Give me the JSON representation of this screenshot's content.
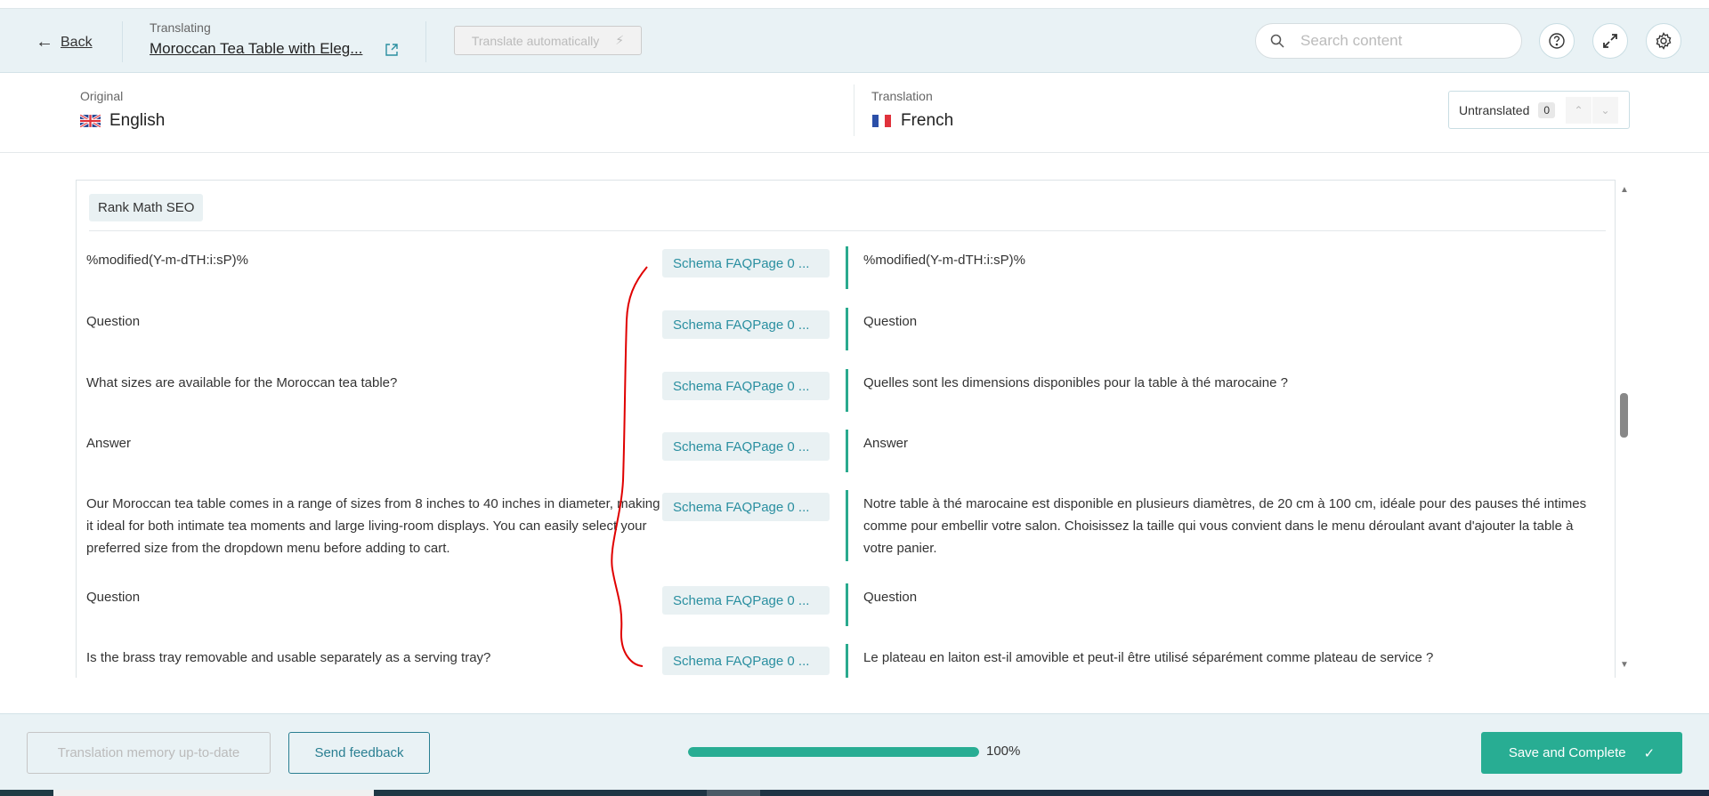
{
  "header": {
    "back_label": "Back",
    "translating_label": "Translating",
    "title": "Moroccan Tea Table with Eleg...",
    "auto_translate_label": "Translate automatically",
    "search_placeholder": "Search content"
  },
  "languages": {
    "original_label": "Original",
    "original_lang": "English",
    "translation_label": "Translation",
    "translation_lang": "French",
    "untranslated_label": "Untranslated",
    "untranslated_count": "0"
  },
  "content": {
    "section": "Rank Math SEO",
    "rows": [
      {
        "source": "%modified(Y-m-dTH:i:sP)%",
        "tag": "Schema FAQPage 0 ...",
        "target": "%modified(Y-m-dTH:i:sP)%"
      },
      {
        "source": "Question",
        "tag": "Schema FAQPage 0 ...",
        "target": "Question"
      },
      {
        "source": "What sizes are available for the Moroccan tea table?",
        "tag": "Schema FAQPage 0 ...",
        "target": "Quelles sont les dimensions disponibles pour la table à thé marocaine ?"
      },
      {
        "source": "Answer",
        "tag": "Schema FAQPage 0 ...",
        "target": "Answer"
      },
      {
        "source": "Our Moroccan tea table comes in a range of sizes from 8 inches to 40 inches in diameter, making it ideal for both intimate tea moments and large living-room displays. You can easily select your preferred size from the dropdown menu before adding to cart.",
        "tag": "Schema FAQPage 0 ...",
        "target": "Notre table à thé marocaine est disponible en plusieurs diamètres, de 20 cm à 100 cm, idéale pour des pauses thé intimes comme pour embellir votre salon. Choisissez la taille qui vous convient dans le menu déroulant avant d'ajouter la table à votre panier."
      },
      {
        "source": "Question",
        "tag": "Schema FAQPage 0 ...",
        "target": "Question"
      },
      {
        "source": "Is the brass tray removable and usable separately as a serving tray?",
        "tag": "Schema FAQPage 0 ...",
        "target": "Le plateau en laiton est-il amovible et peut-il être utilisé séparément comme plateau de service ?"
      }
    ]
  },
  "footer": {
    "memory_label": "Translation memory up-to-date",
    "feedback_label": "Send feedback",
    "progress_percent": 100,
    "progress_label": "100%",
    "save_label": "Save and Complete"
  },
  "colors": {
    "accent": "#28ad93",
    "link": "#2a8fa0",
    "annotation": "#e00000"
  }
}
